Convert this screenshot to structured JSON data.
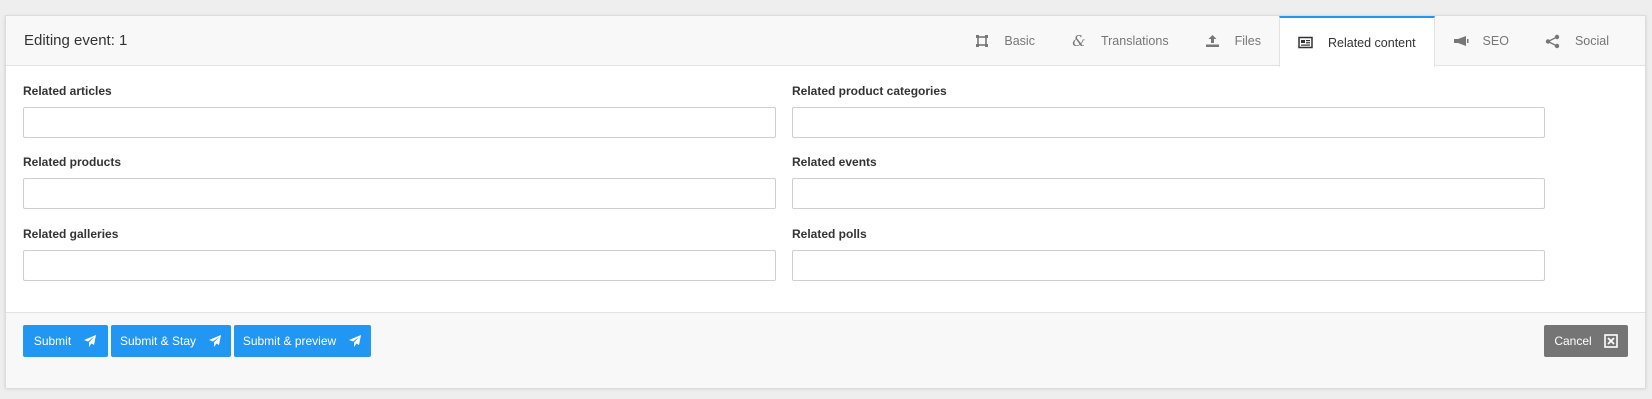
{
  "header": {
    "title": "Editing event: 1",
    "tabs": [
      {
        "label": "Basic",
        "icon": "crop-frame-icon"
      },
      {
        "label": "Translations",
        "icon": "ampersand-icon"
      },
      {
        "label": "Files",
        "icon": "upload-icon"
      },
      {
        "label": "Related content",
        "icon": "newspaper-icon",
        "active": true
      },
      {
        "label": "SEO",
        "icon": "megaphone-icon"
      },
      {
        "label": "Social",
        "icon": "share-icon"
      }
    ]
  },
  "form": {
    "fields": [
      {
        "label": "Related articles",
        "value": "",
        "placeholder": ""
      },
      {
        "label": "Related product categories",
        "value": "",
        "placeholder": ""
      },
      {
        "label": "Related products",
        "value": "",
        "placeholder": ""
      },
      {
        "label": "Related events",
        "value": "",
        "placeholder": ""
      },
      {
        "label": "Related galleries",
        "value": "",
        "placeholder": ""
      },
      {
        "label": "Related polls",
        "value": "",
        "placeholder": ""
      }
    ]
  },
  "footer": {
    "submit_label": "Submit",
    "submit_stay_label": "Submit & Stay",
    "submit_preview_label": "Submit & preview",
    "cancel_label": "Cancel"
  },
  "colors": {
    "accent": "#2196f3",
    "cancel": "#757575"
  }
}
